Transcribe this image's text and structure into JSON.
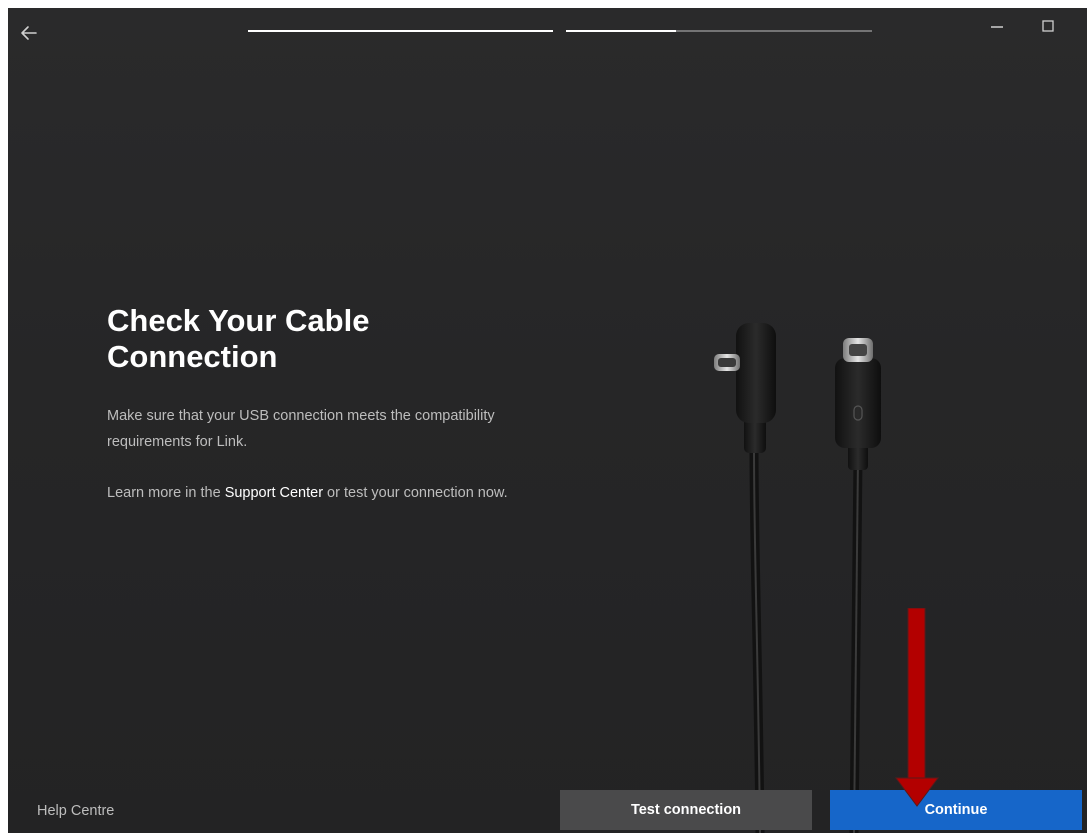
{
  "header": {
    "back_icon": "arrow-left-icon",
    "progress": [
      {
        "fill": 1.0
      },
      {
        "fill": 0.36
      }
    ],
    "minimize_icon": "minimize-icon",
    "maximize_icon": "maximize-icon"
  },
  "main": {
    "title": "Check Your Cable Connection",
    "para1": "Make sure that your USB connection meets the compatibility requirements for Link.",
    "para2_prefix": "Learn more in the ",
    "para2_link": "Support Center",
    "para2_suffix": " or test your connection now."
  },
  "footer": {
    "help_label": "Help Centre",
    "test_button_label": "Test connection",
    "continue_button_label": "Continue"
  },
  "colors": {
    "background": "#262627",
    "primary_button": "#1666c9",
    "secondary_button": "#4a4a4b",
    "annotation_arrow": "#b30000"
  }
}
